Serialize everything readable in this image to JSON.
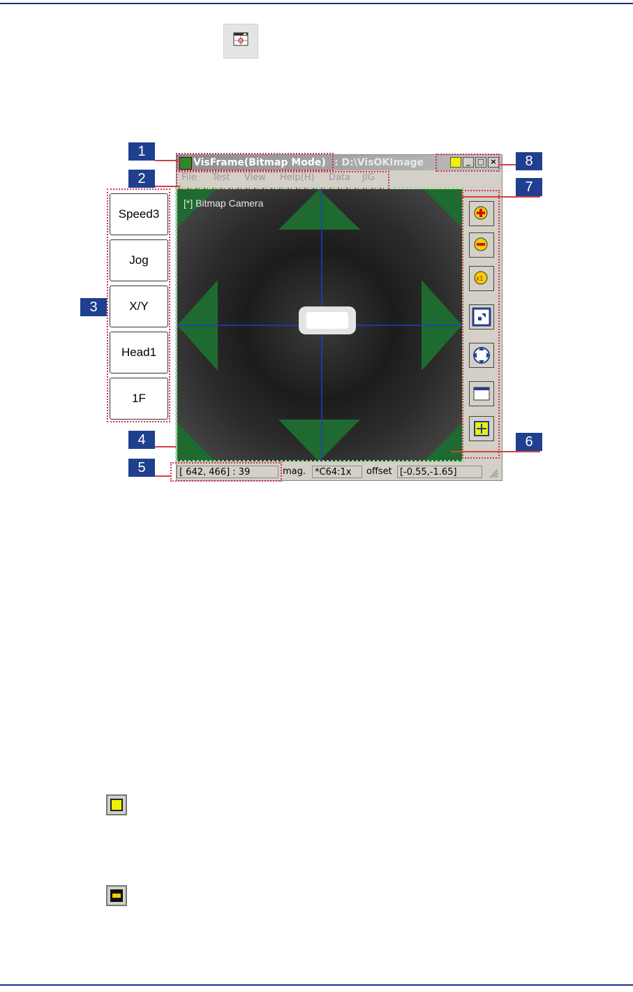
{
  "window": {
    "title": "VisFrame(Bitmap Mode)",
    "path": ": D:\\VisOKImage",
    "menu": [
      "File",
      "Test",
      "View",
      "Help(H)",
      "Data",
      "JIG"
    ],
    "camera_label": "[*] Bitmap Camera",
    "status": {
      "position": "[ 642, 466] : 39",
      "mag_label": "mag.",
      "mag_value": "*C64:1x",
      "offset_label": "offset",
      "offset_value": "[-0.55,-1.65]"
    }
  },
  "side_buttons": [
    "Speed3",
    "Jog",
    "X/Y",
    "Head1",
    "1F"
  ],
  "callouts": [
    "1",
    "2",
    "3",
    "4",
    "5",
    "6",
    "7",
    "8"
  ],
  "toolbar_icons": [
    "zoom-in-icon",
    "zoom-out-icon",
    "zoom-1x-icon",
    "fit-icon",
    "move-arrows-icon",
    "window-icon",
    "pan-icon"
  ],
  "colors": {
    "callout_bg": "#1f3f8f",
    "highlight_dash": "#d0305a",
    "crosshair": "#1d3fc4",
    "overlay_triangle": "#1f6a30"
  }
}
